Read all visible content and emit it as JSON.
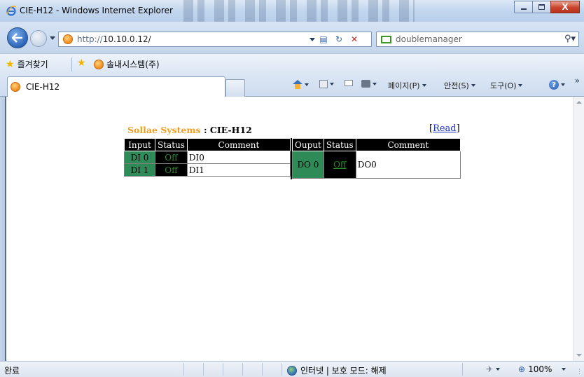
{
  "window": {
    "title": "CIE-H12 - Windows Internet Explorer",
    "close_label": "X"
  },
  "address_bar": {
    "url_prefix": "http://",
    "url_host": "10.10.0.12/",
    "search_placeholder": "doublemanager"
  },
  "favorites_bar": {
    "favorites_label": "즐겨찾기",
    "site_label": "솔내시스템(주)"
  },
  "tab": {
    "label": "CIE-H12"
  },
  "command_bar": {
    "page_label": "페이지(P)",
    "safety_label": "안전(S)",
    "tools_label": "도구(O)",
    "more_label": "»"
  },
  "page": {
    "brand": "Sollae Systems",
    "model": " : CIE-H12",
    "read_open": "[",
    "read_label": "Read",
    "read_close": "]",
    "input_table": {
      "headers": [
        "Input",
        "Status",
        "Comment"
      ],
      "rows": [
        {
          "channel": "DI 0",
          "status": "Off",
          "comment": "DI0"
        },
        {
          "channel": "DI 1",
          "status": "Off",
          "comment": "DI1"
        }
      ]
    },
    "output_table": {
      "headers": [
        "Ouput",
        "Status",
        "Comment"
      ],
      "rows": [
        {
          "channel": "DO 0",
          "status": "Off",
          "comment": "DO0"
        }
      ]
    }
  },
  "status_bar": {
    "status": "완료",
    "zone": "인터넷 | 보호 모드: 해제",
    "zoom": "100%"
  },
  "colors": {
    "brand": "#f0a020",
    "channel_bg": "#2e8b57",
    "status_text": "#2e8b2e",
    "header_bg": "#000000",
    "link": "#1a35c8"
  }
}
